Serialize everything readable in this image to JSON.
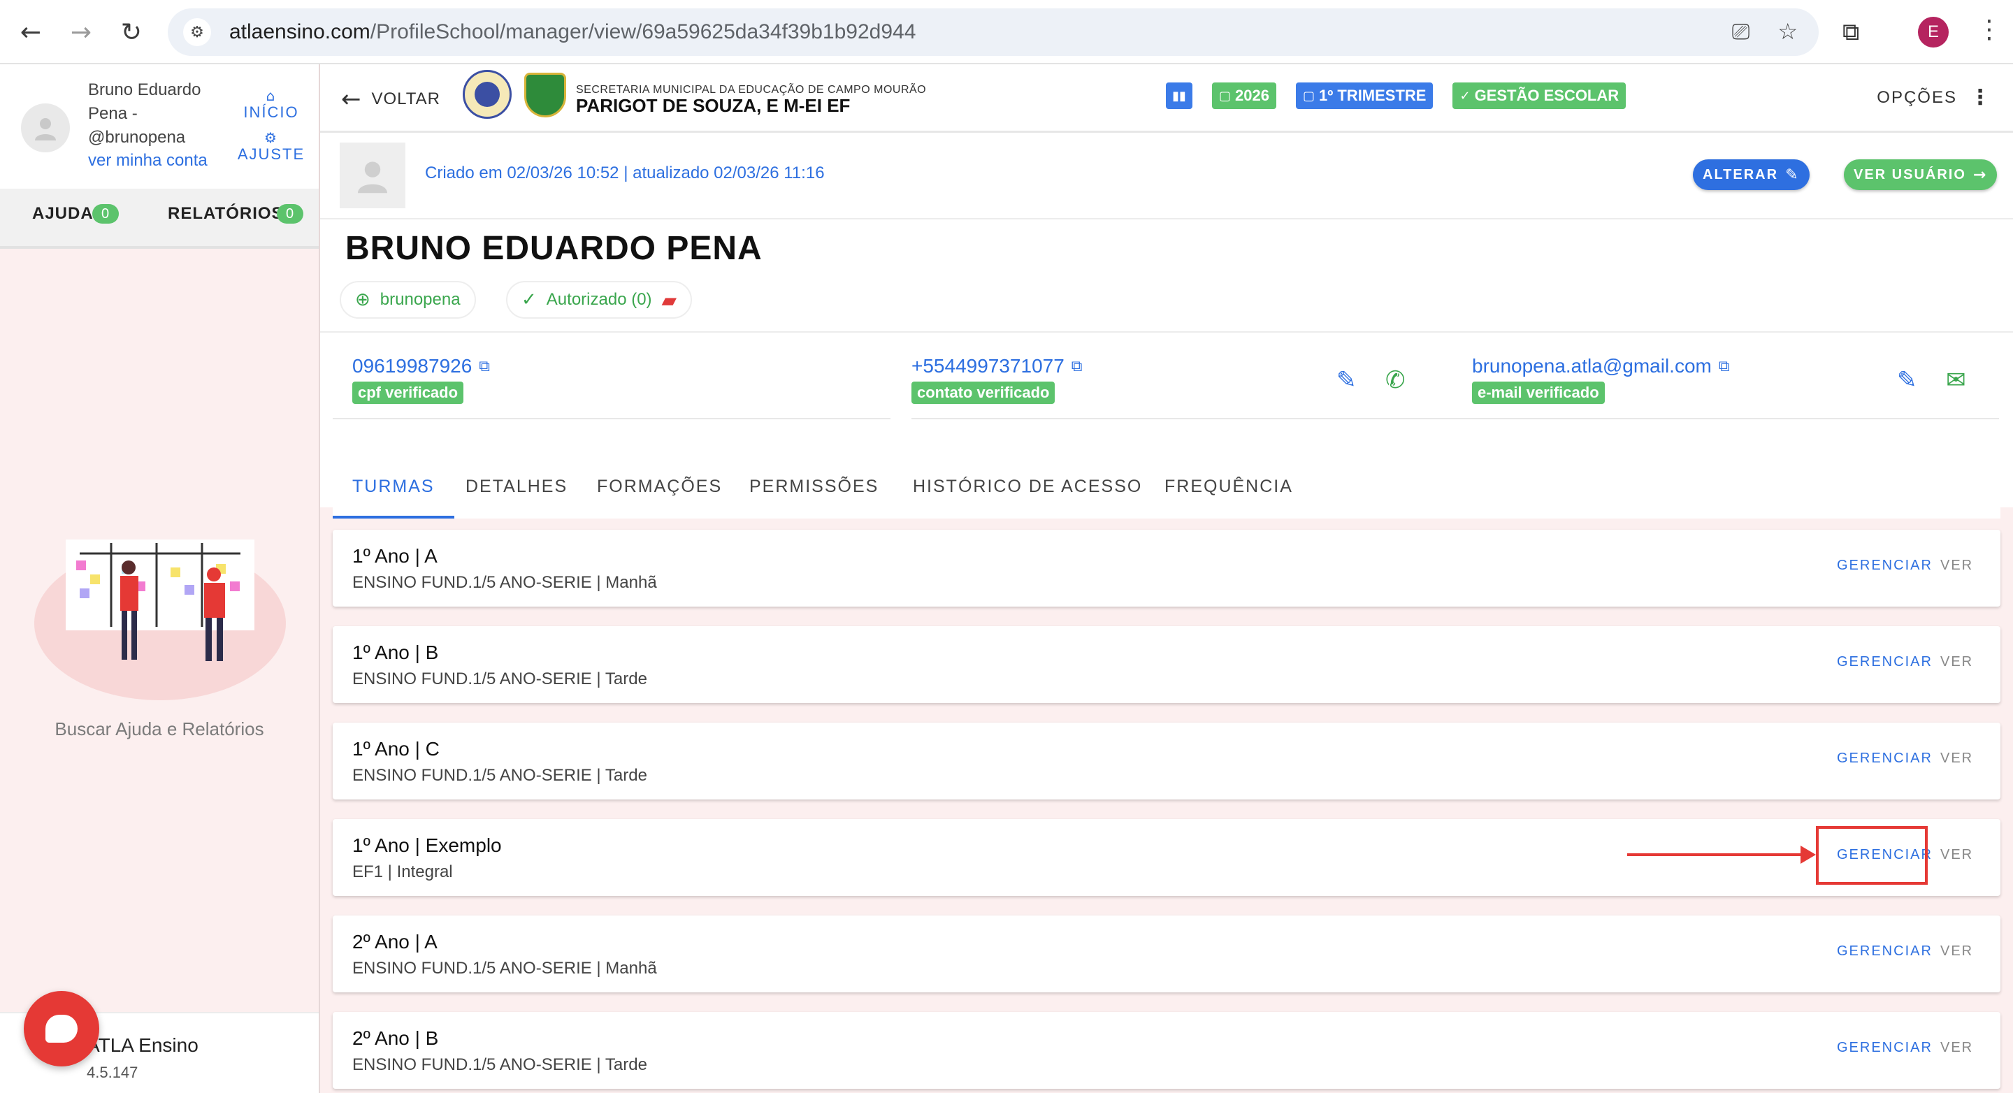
{
  "browser": {
    "url_host": "atlaensino.com",
    "url_path": "/ProfileSchool/manager/view/69a59625da34f39b1b92d944",
    "profile_initial": "E"
  },
  "sidebar": {
    "user_name": "Bruno Eduardo Pena - @brunopena",
    "view_account": "ver minha conta",
    "inicio": "INÍCIO",
    "ajuste": "AJUSTE",
    "tabs": [
      {
        "label": "AJUDA",
        "badge": "0"
      },
      {
        "label": "RELATÓRIOS",
        "badge": "0"
      }
    ],
    "help_text": "Buscar Ajuda e Relatórios",
    "brand": "ATLA Ensino",
    "version": "4.5.147"
  },
  "header": {
    "back_label": "VOLTAR",
    "school_subtitle": "SECRETARIA MUNICIPAL DA EDUCAÇÃO DE CAMPO MOURÃO",
    "school_name": "PARIGOT DE SOUZA, E M-EI EF",
    "chips": [
      {
        "label": "",
        "color": "#3b7be8"
      },
      {
        "label": "2026",
        "color": "#5cc36c"
      },
      {
        "label": "1º TRIMESTRE",
        "color": "#3b7be8"
      },
      {
        "label": "GESTÃO ESCOLAR",
        "color": "#5cc36c"
      }
    ],
    "options_label": "OPÇÕES"
  },
  "profile": {
    "meta": "Criado em 02/03/26 10:52 | atualizado 02/03/26 11:16",
    "alterar": "ALTERAR",
    "ver_usuario": "VER USUÁRIO",
    "name": "BRUNO EDUARDO PENA",
    "username": "brunopena",
    "authorized": "Autorizado (0)",
    "contacts": [
      {
        "value": "09619987926",
        "badge": "cpf verificado"
      },
      {
        "value": "+5544997371077",
        "badge": "contato verificado"
      },
      {
        "value": "brunopena.atla@gmail.com",
        "badge": "e-mail verificado"
      }
    ]
  },
  "tabs": [
    "TURMAS",
    "DETALHES",
    "FORMAÇÕES",
    "PERMISSÕES",
    "HISTÓRICO DE ACESSO",
    "FREQUÊNCIA"
  ],
  "classes": [
    {
      "title": "1º Ano | A",
      "sub": "ENSINO FUND.1/5 ANO-SERIE | Manhã"
    },
    {
      "title": "1º Ano | B",
      "sub": "ENSINO FUND.1/5 ANO-SERIE | Tarde"
    },
    {
      "title": "1º Ano | C",
      "sub": "ENSINO FUND.1/5 ANO-SERIE | Tarde"
    },
    {
      "title": "1º Ano | Exemplo",
      "sub": "EF1 | Integral"
    },
    {
      "title": "2º Ano | A",
      "sub": "ENSINO FUND.1/5 ANO-SERIE | Manhã"
    },
    {
      "title": "2º Ano | B",
      "sub": "ENSINO FUND.1/5 ANO-SERIE | Tarde"
    }
  ],
  "row_actions": {
    "manage": "GERENCIAR",
    "view": "VER"
  },
  "colors": {
    "accent": "#2d6fe0",
    "success": "#5cc36c",
    "danger": "#e53935"
  }
}
